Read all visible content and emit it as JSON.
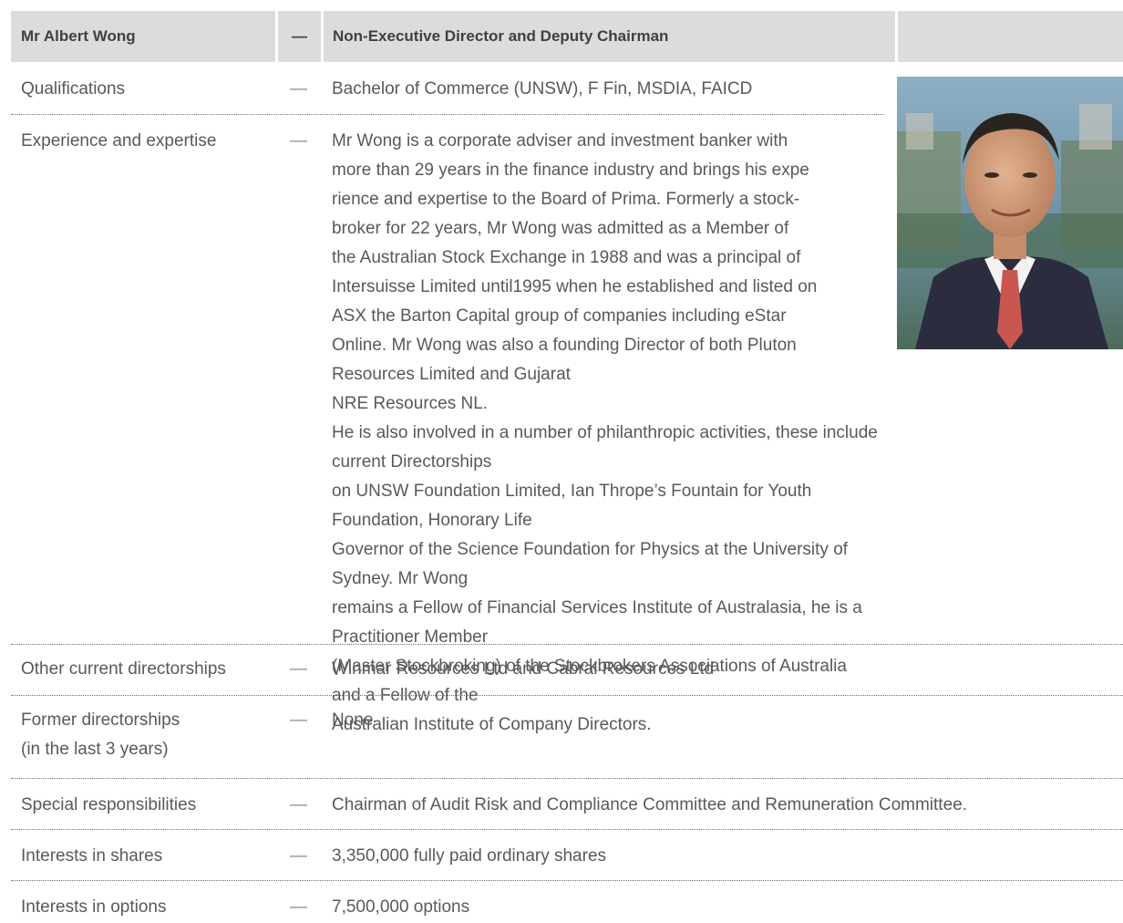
{
  "header": {
    "name": "Mr Albert Wong",
    "dash": "—",
    "role": "Non-Executive Director and Deputy Chairman"
  },
  "dash": "—",
  "rows": [
    {
      "label": "Qualifications",
      "value": "Bachelor of Commerce (UNSW), F Fin, MSDIA, FAICD"
    },
    {
      "label": "Experience and expertise",
      "lines_narrow": [
        "Mr Wong is a corporate adviser and investment banker with",
        "more than 29 years in the finance industry and brings his expe",
        "rience and expertise to the Board of Prima. Formerly a stock-",
        "broker for 22 years, Mr Wong was admitted as a Member of",
        "the Australian Stock Exchange in 1988 and was a principal of",
        "Intersuisse Limited until1995 when he established and listed on",
        "ASX the Barton Capital group of companies including eStar"
      ],
      "lines_wide": [
        "Online. Mr Wong was also a founding Director of both Pluton Resources Limited and Gujarat",
        "NRE Resources NL.",
        "He is also involved in a number of philanthropic activities, these include current Directorships",
        "on UNSW Foundation Limited, Ian Thrope’s Fountain for Youth Foundation, Honorary Life",
        "Governor of the Science Foundation for Physics at the University of Sydney. Mr Wong",
        "remains a Fellow of Financial Services Institute of Australasia, he is a Practitioner Member",
        "(Master Stockbroking) of the Stockbrokers Associations of Australia and a Fellow of the",
        "Australian Institute of Company Directors."
      ]
    },
    {
      "label": "Other current directorships",
      "value": "Winmar Resources Ltd and Cabral Resources Ltd"
    },
    {
      "label_lines": [
        "Former directorships",
        "(in the last 3 years)"
      ],
      "value": "None"
    },
    {
      "label": "Special responsibilities",
      "value": "Chairman of Audit Risk and Compliance Committee and Remuneration Committee."
    },
    {
      "label": "Interests in shares",
      "value": "3,350,000 fully paid ordinary shares"
    },
    {
      "label": "Interests in options",
      "value": "7,500,000 options"
    }
  ]
}
